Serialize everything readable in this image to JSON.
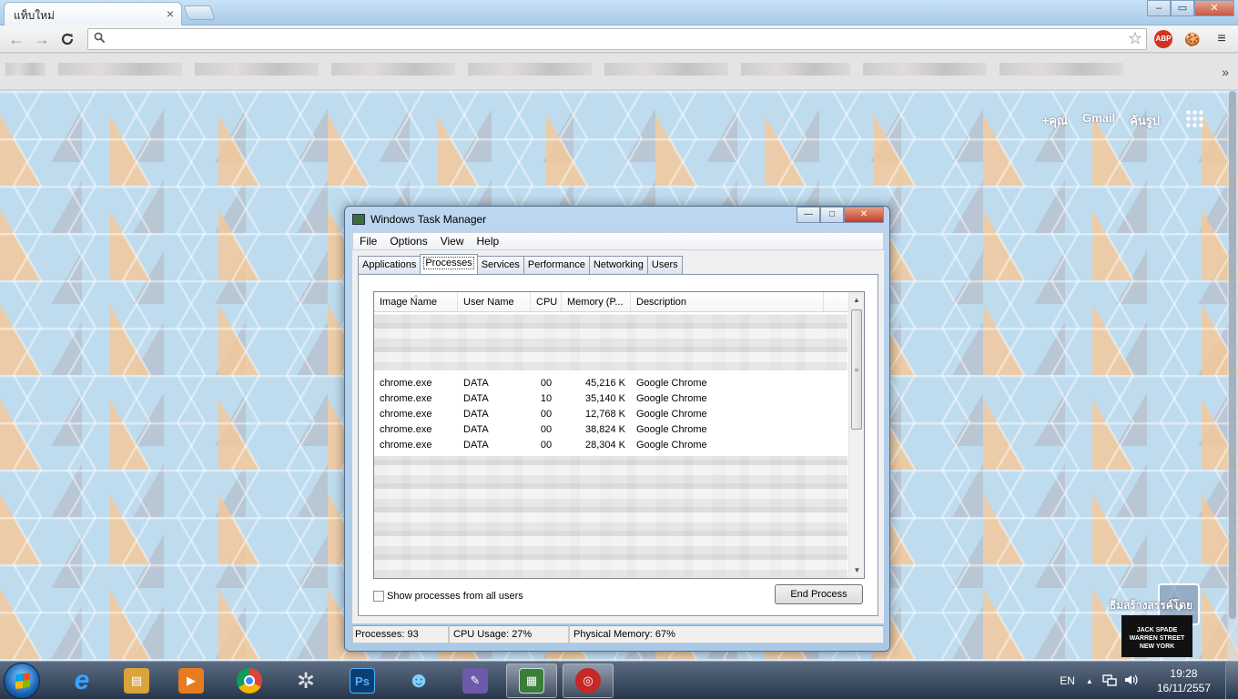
{
  "browser": {
    "tab_title": "แท็บใหม่",
    "tab_close": "×",
    "window_controls": {
      "minimize": "–",
      "maximize": "▭",
      "close": "✕"
    },
    "nav": {
      "back": "←",
      "forward": "→",
      "reload": "C"
    },
    "omnibox_value": "",
    "bookmarks_more": "»",
    "extensions": [
      {
        "name": "adblock-plus",
        "label": "ABP",
        "color": "#d2321f"
      },
      {
        "name": "cookie",
        "label": "🍪",
        "color": "#b07a2e"
      }
    ]
  },
  "newtab_page": {
    "links": [
      "+คุณ",
      "Gmail",
      "ค้นรูป"
    ],
    "theme_credit": "ธีมสร้างสรรค์โดย",
    "theme_logo": [
      "JACK SPADE",
      "WARREN STREET",
      "NEW YORK"
    ],
    "scroll_down_glyph": "⌄"
  },
  "task_manager": {
    "title": "Windows Task Manager",
    "controls": {
      "minimize": "—",
      "maximize": "□",
      "close": "✕"
    },
    "menu": [
      "File",
      "Options",
      "View",
      "Help"
    ],
    "tabs": [
      {
        "label": "Applications",
        "active": false
      },
      {
        "label": "Processes",
        "active": true
      },
      {
        "label": "Services",
        "active": false
      },
      {
        "label": "Performance",
        "active": false
      },
      {
        "label": "Networking",
        "active": false
      },
      {
        "label": "Users",
        "active": false
      }
    ],
    "columns": [
      "Image Name",
      "User Name",
      "CPU",
      "Memory (P...",
      "Description"
    ],
    "sort_arrow": "^",
    "rows": [
      {
        "image": "chrome.exe",
        "user": "DATA",
        "cpu": "00",
        "memory": "45,216 K",
        "desc": "Google Chrome"
      },
      {
        "image": "chrome.exe",
        "user": "DATA",
        "cpu": "10",
        "memory": "35,140 K",
        "desc": "Google Chrome"
      },
      {
        "image": "chrome.exe",
        "user": "DATA",
        "cpu": "00",
        "memory": "12,768 K",
        "desc": "Google Chrome"
      },
      {
        "image": "chrome.exe",
        "user": "DATA",
        "cpu": "00",
        "memory": "38,824 K",
        "desc": "Google Chrome"
      },
      {
        "image": "chrome.exe",
        "user": "DATA",
        "cpu": "00",
        "memory": "28,304 K",
        "desc": "Google Chrome"
      }
    ],
    "scroll": {
      "up": "▲",
      "down": "▼",
      "grip": "≡"
    },
    "show_all_label": "Show processes from all users",
    "show_all_checked": false,
    "end_process_label": "End Process",
    "status": {
      "processes": "Processes: 93",
      "cpu": "CPU Usage: 27%",
      "memory": "Physical Memory: 67%"
    }
  },
  "taskbar": {
    "apps": [
      {
        "name": "internet-explorer",
        "glyph": "e",
        "color": "#1e88e5",
        "active": false
      },
      {
        "name": "file-explorer",
        "glyph": "▤",
        "color": "#d9a43a",
        "active": false
      },
      {
        "name": "media-player",
        "glyph": "▶",
        "color": "#e77b1f",
        "active": false
      },
      {
        "name": "chrome",
        "glyph": "◉",
        "color": "#db4437",
        "active": false
      },
      {
        "name": "app-gear",
        "glyph": "✲",
        "color": "#555",
        "active": false
      },
      {
        "name": "photoshop",
        "glyph": "Ps",
        "color": "#0c3e73",
        "active": false
      },
      {
        "name": "messenger",
        "glyph": "☻",
        "color": "#3a9ad9",
        "active": false
      },
      {
        "name": "paint-tool",
        "glyph": "✎",
        "color": "#6d5aa8",
        "active": false
      },
      {
        "name": "task-manager",
        "glyph": "▦",
        "color": "#3b7d3a",
        "active": true
      },
      {
        "name": "app-red",
        "glyph": "◎",
        "color": "#c62828",
        "active": true
      }
    ],
    "language": "EN",
    "tray_up": "▲",
    "time": "19:28",
    "date": "16/11/2557"
  }
}
